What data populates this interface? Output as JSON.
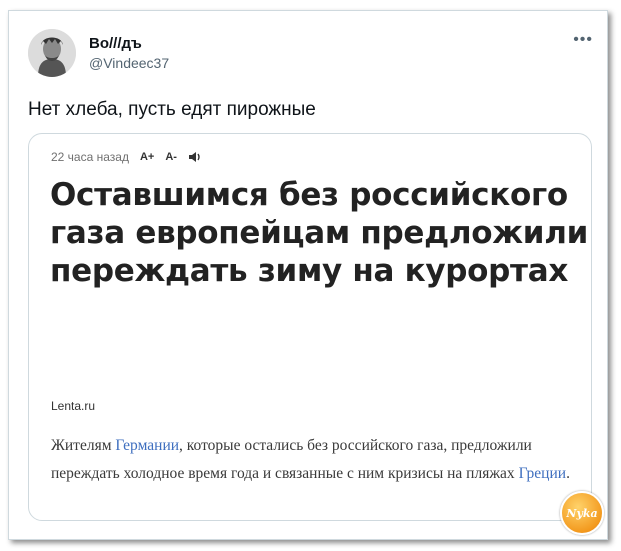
{
  "author": {
    "name": "Во///дъ",
    "handle": "@Vindeec37"
  },
  "more_icon": "more-icon",
  "tweet": {
    "text": "Нет хлеба, пусть едят пирожные"
  },
  "card": {
    "time_ago": "22 часа назад",
    "font_increase": "A+",
    "font_decrease": "A-",
    "headline": "Оставшимся без российского газа европейцам предложили переждать зиму на курортах",
    "source": "Lenta.ru",
    "lede": {
      "part1": "Жителям ",
      "link1": "Германии",
      "part2": ", которые остались без российского газа, предложили переждать холодное время года и связанные с ним кризисы на пляжах ",
      "link2": "Греции",
      "part3": "."
    }
  },
  "watermark": "Nyka",
  "colors": {
    "link": "#3f6fbf",
    "watermark": "#f39a1f"
  }
}
